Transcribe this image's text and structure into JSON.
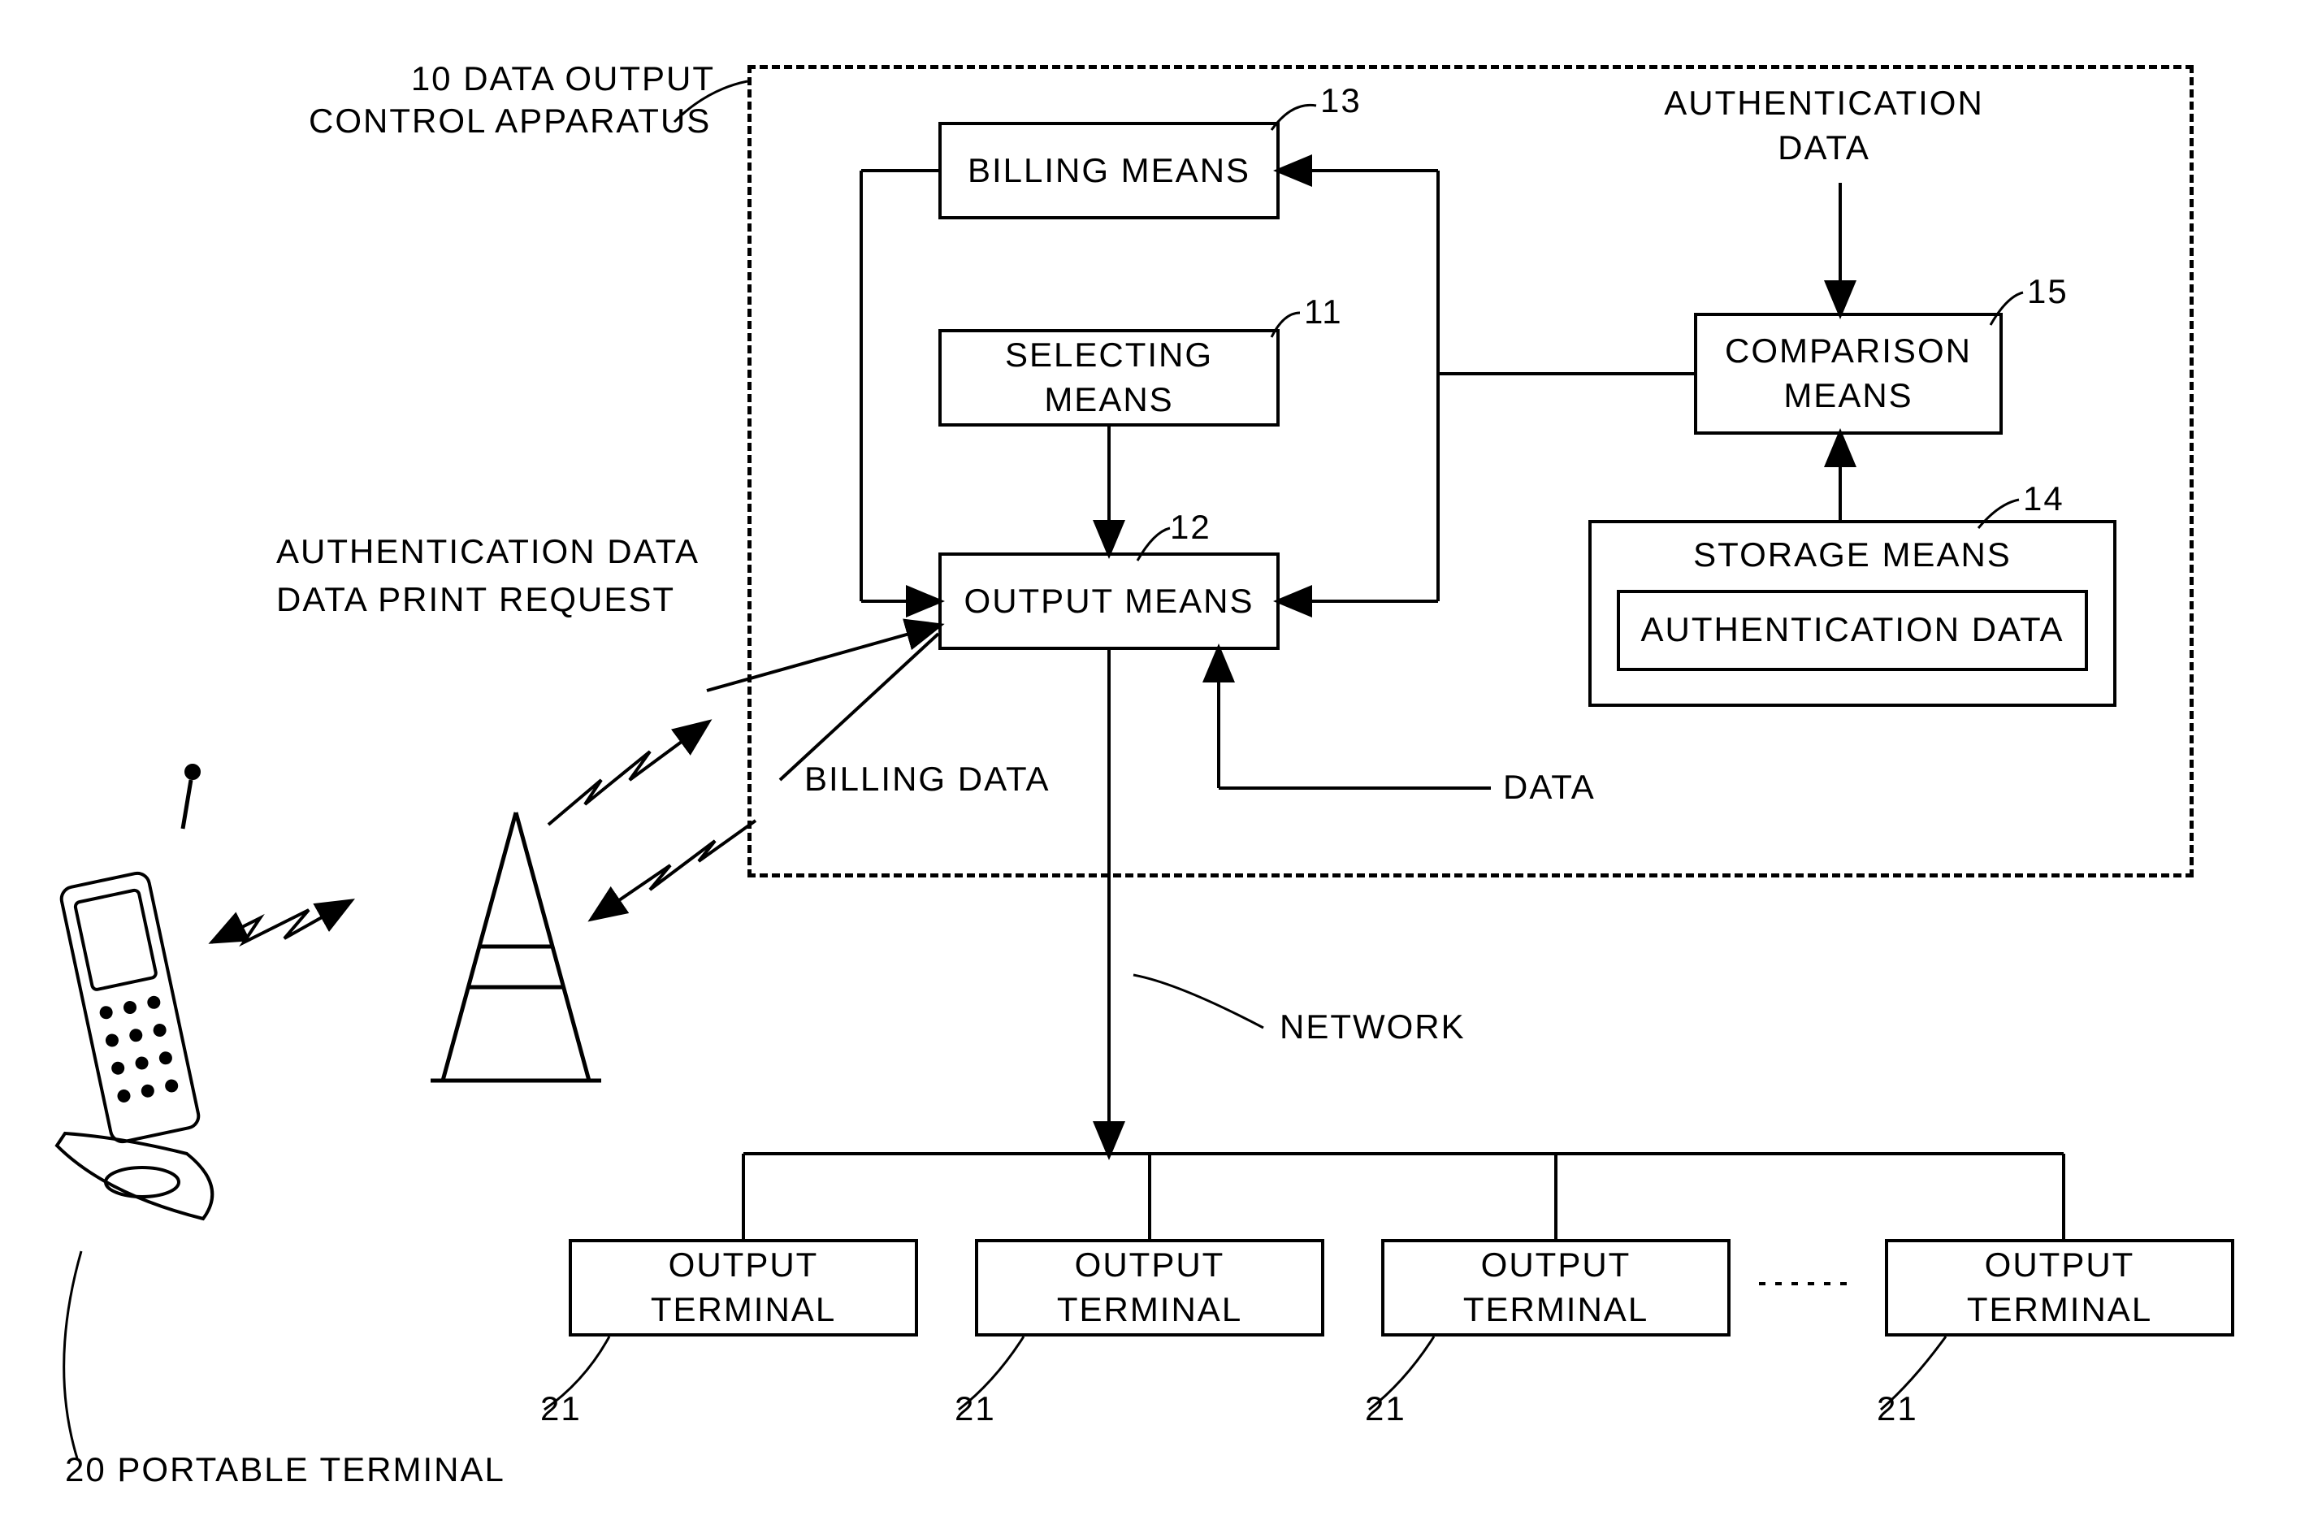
{
  "apparatus": {
    "ref": "10",
    "label": "DATA OUTPUT\nCONTROL APPARATUS"
  },
  "boxes": {
    "billing": {
      "ref": "13",
      "label": "BILLING MEANS"
    },
    "selecting": {
      "ref": "11",
      "label": "SELECTING MEANS"
    },
    "output": {
      "ref": "12",
      "label": "OUTPUT MEANS"
    },
    "comparison": {
      "ref": "15",
      "label": "COMPARISON\nMEANS"
    },
    "storage": {
      "ref": "14",
      "label": "STORAGE MEANS",
      "inner": "AUTHENTICATION DATA"
    }
  },
  "terminals": {
    "ref": "21",
    "label": "OUTPUT TERMINAL"
  },
  "portable": {
    "ref": "20",
    "label": "PORTABLE  TERMINAL"
  },
  "annotations": {
    "auth_data": "AUTHENTICATION\nDATA",
    "auth_request": "AUTHENTICATION DATA\nDATA PRINT REQUEST",
    "billing_data": "BILLING DATA",
    "data": "DATA",
    "network": "NETWORK"
  }
}
